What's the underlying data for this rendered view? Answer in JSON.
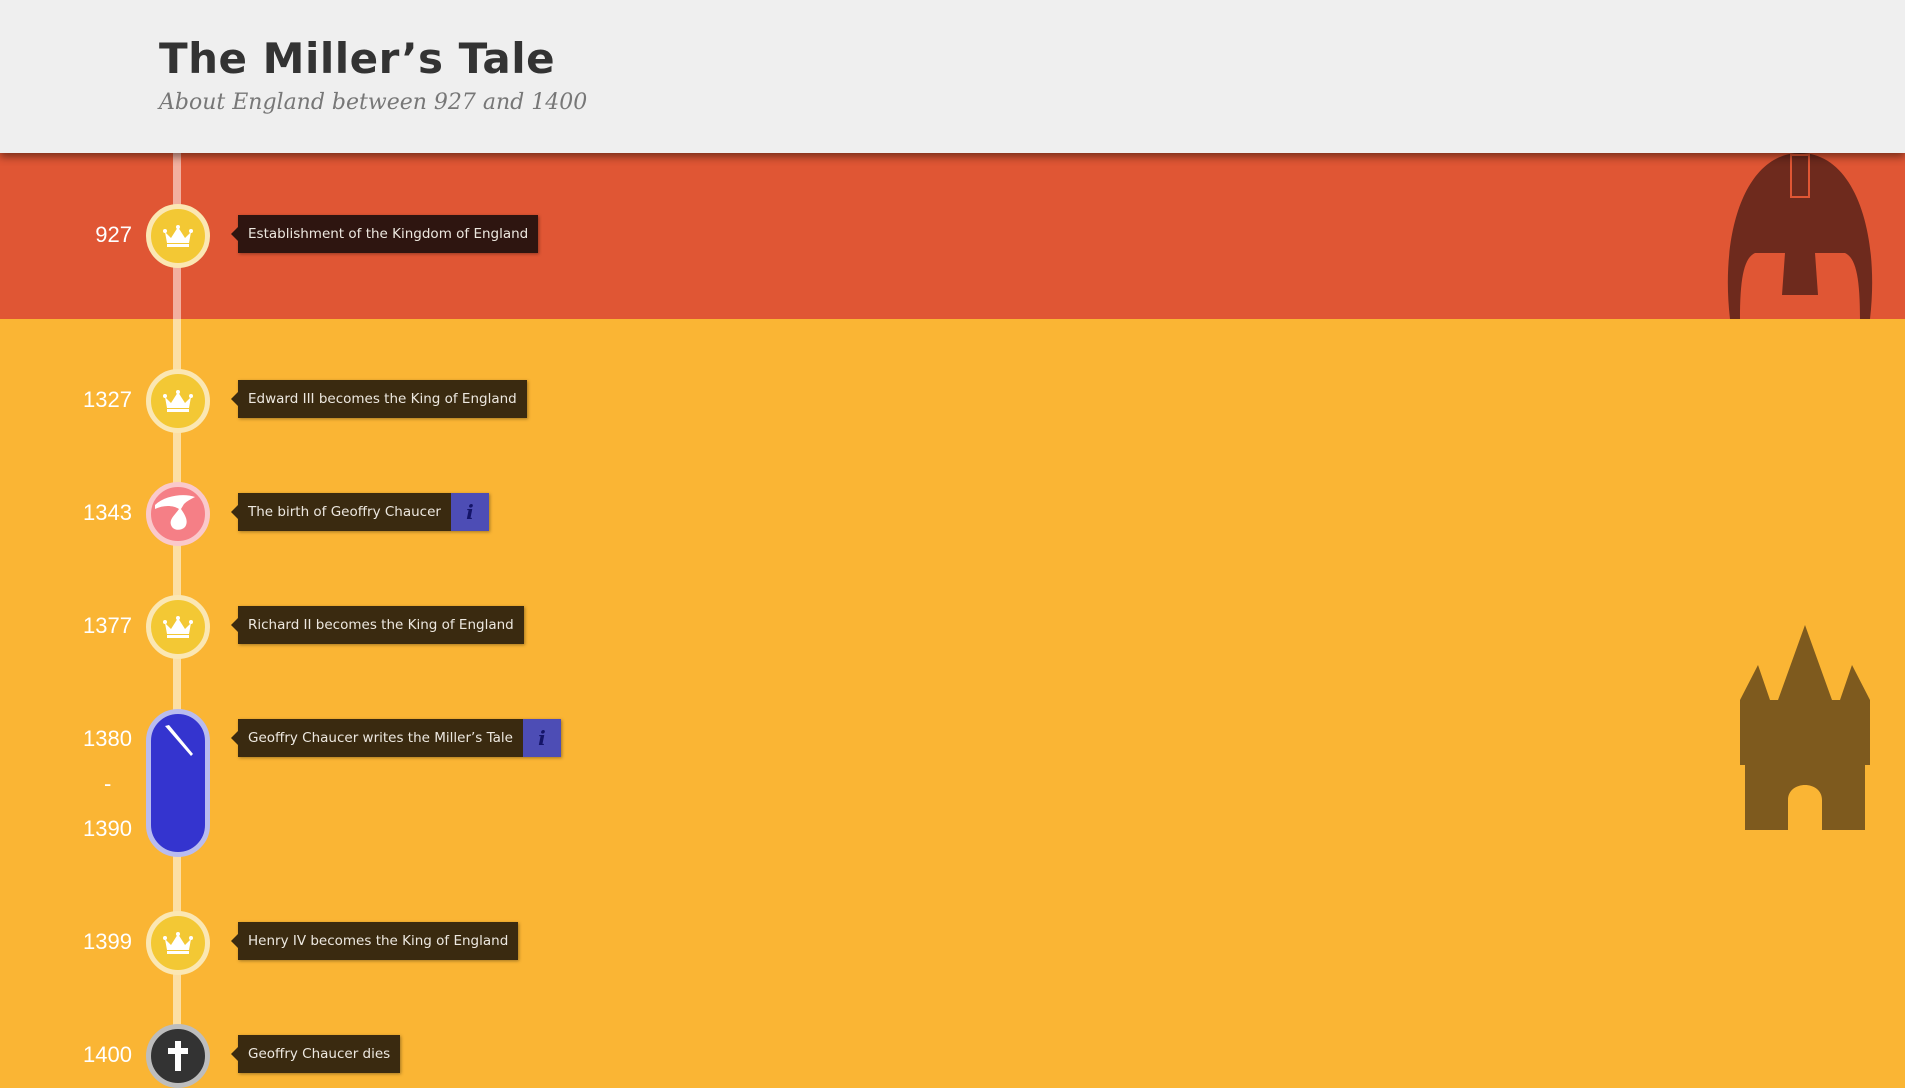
{
  "header": {
    "title": "The Miller’s Tale",
    "subtitle": "About England between 927 and 1400"
  },
  "colors": {
    "header_bg": "#EFEFEF",
    "band_red": "#E05634",
    "band_yellow": "#FAB534",
    "label_bg": "#3A2A10",
    "info_bg": "#4D4DB5",
    "crown_node": "#F3C834",
    "birth_node": "#F57F86",
    "period_node": "#3434CF",
    "death_node": "#333333"
  },
  "events": [
    {
      "year": "927",
      "label": "Establishment of the Kingdom of England",
      "icon": "crown-icon"
    },
    {
      "year": "1327",
      "label": "Edward III becomes the King of England",
      "icon": "crown-icon"
    },
    {
      "year": "1343",
      "label": "The birth of Geoffry Chaucer",
      "icon": "stork-icon",
      "info": "i"
    },
    {
      "year": "1377",
      "label": "Richard II becomes the King of England",
      "icon": "crown-icon"
    },
    {
      "year_start": "1380",
      "year_sep": "-",
      "year_end": "1390",
      "label": "Geoffry Chaucer writes the Miller’s Tale",
      "icon": "quill-icon",
      "info": "i"
    },
    {
      "year": "1399",
      "label": "Henry IV becomes the King of England",
      "icon": "crown-icon"
    },
    {
      "year": "1400",
      "label": "Geoffry Chaucer dies",
      "icon": "cross-icon"
    }
  ],
  "decorations": [
    "helmet-icon",
    "castle-icon"
  ]
}
